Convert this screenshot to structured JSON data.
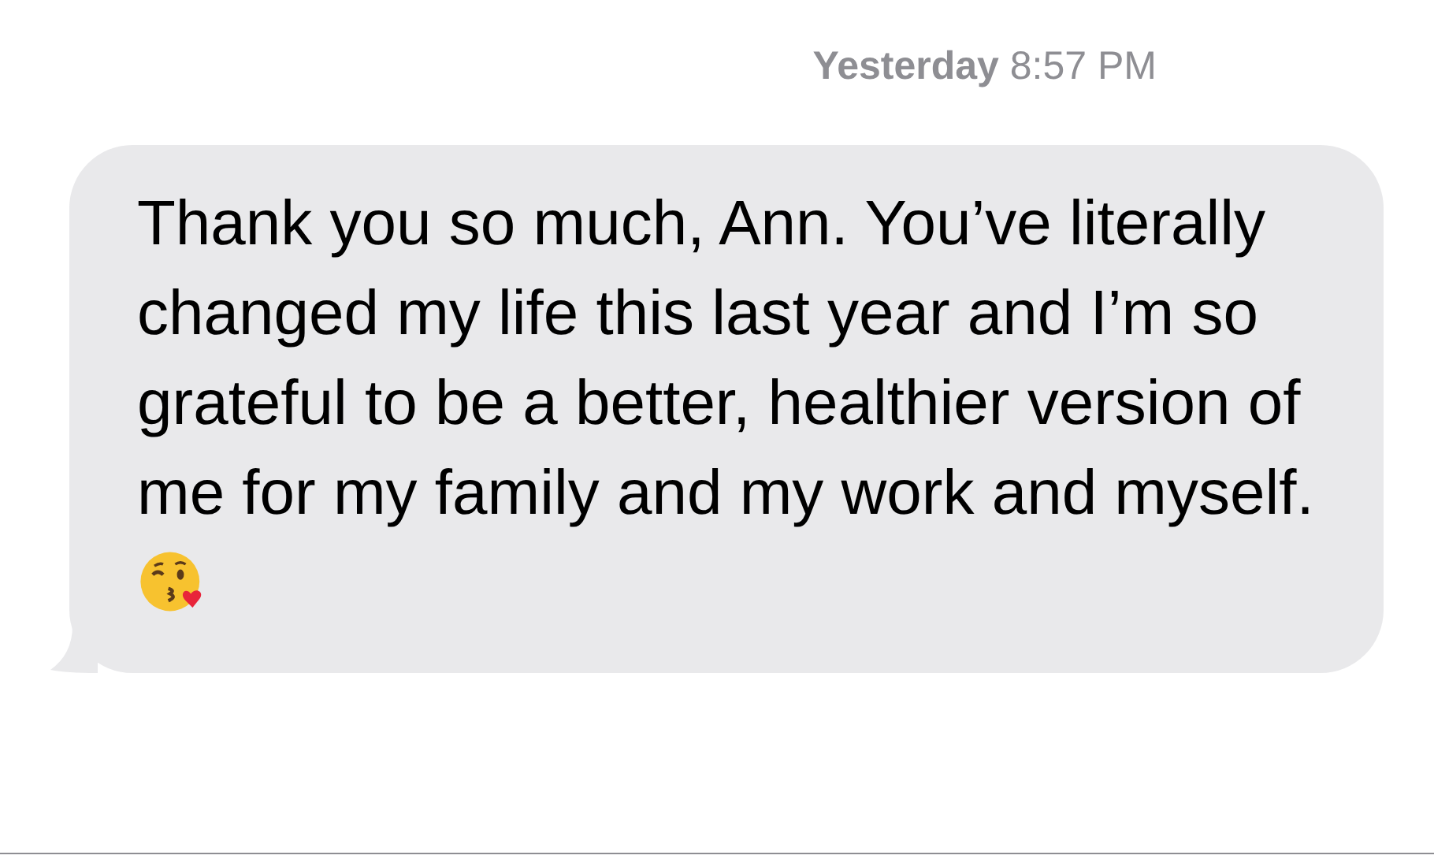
{
  "timestamp": "**Yesterday** 8:57 PM",
  "message": {
    "text": "Thank you so much, Ann. You’ve literally changed my life this last year and I’m so grateful to be a better, healthier version of me for my family and my work and myself.",
    "emoji": true
  }
}
